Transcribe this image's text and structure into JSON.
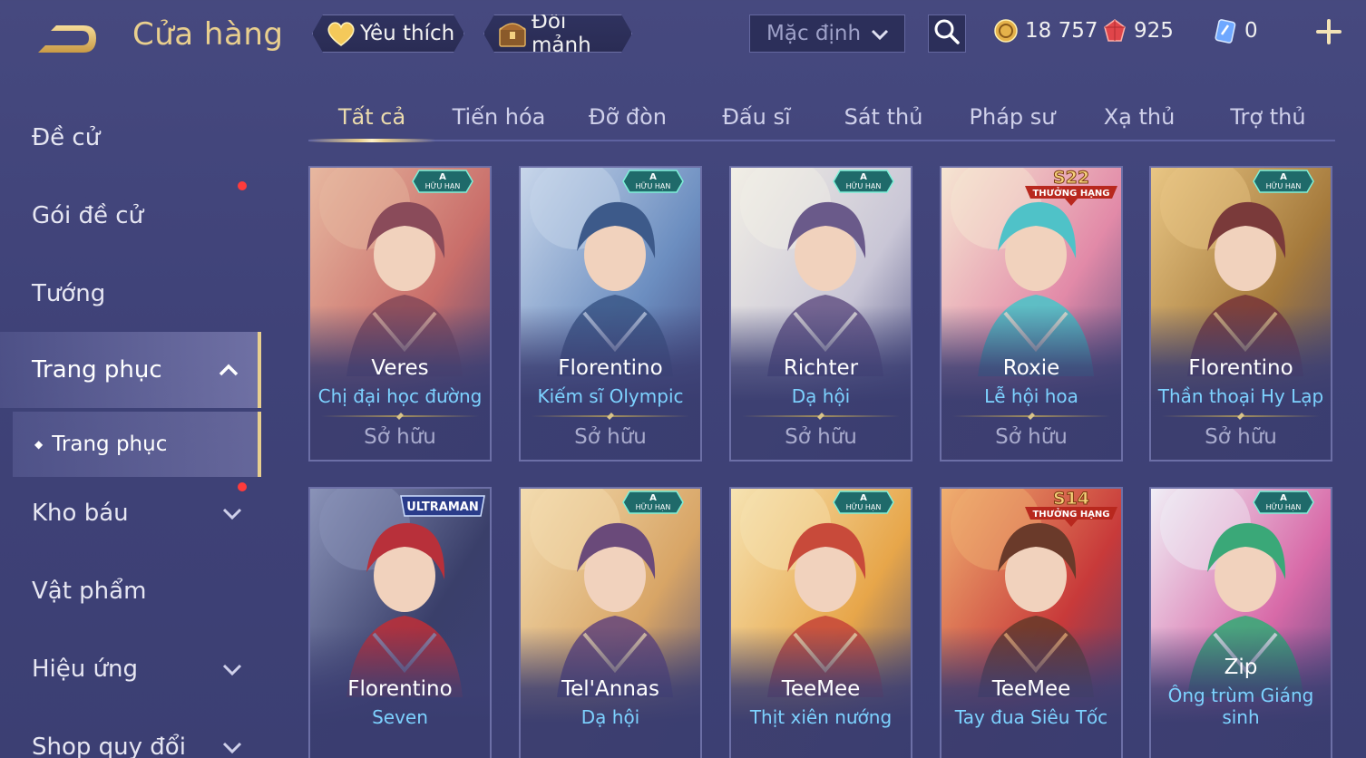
{
  "header": {
    "title": "Cửa hàng",
    "favorite_label": "Yêu thích",
    "exchange_label": "Đổi mảnh",
    "sort_value": "Mặc định",
    "currencies": {
      "gold": "18 757",
      "ruby": "925",
      "voucher": "0"
    }
  },
  "sidebar": {
    "items": [
      {
        "label": "Đề cử"
      },
      {
        "label": "Gói đề cử"
      },
      {
        "label": "Tướng"
      },
      {
        "label": "Trang phục"
      },
      {
        "label": "Kho báu"
      },
      {
        "label": "Vật phẩm"
      },
      {
        "label": "Hiệu ứng"
      },
      {
        "label": "Shop quy đổi"
      }
    ],
    "sub_item": "Trang phục"
  },
  "tabs": [
    "Tất cả",
    "Tiến hóa",
    "Đỡ đòn",
    "Đấu sĩ",
    "Sát thủ",
    "Pháp sư",
    "Xạ thủ",
    "Trợ thủ"
  ],
  "badges": {
    "a_top": "A",
    "a_sub": "HỮU HẠN",
    "rank": "THƯỞNG HẠNG",
    "ultraman": "ULTRAMAN"
  },
  "cards": [
    {
      "hero": "Veres",
      "skin": "Chị đại học đường",
      "status": "Sở hữu",
      "badge": "A",
      "colors": [
        "#c96e6a",
        "#e7b8a0",
        "#8a4b5a"
      ]
    },
    {
      "hero": "Florentino",
      "skin": "Kiếm sĩ Olympic",
      "status": "Sở hữu",
      "badge": "A",
      "colors": [
        "#6c8ec0",
        "#c8d6ea",
        "#3d5a8a"
      ]
    },
    {
      "hero": "Richter",
      "skin": "Dạ hội",
      "status": "Sở hữu",
      "badge": "A",
      "colors": [
        "#c9c6d6",
        "#f2efe6",
        "#6a5a8a"
      ]
    },
    {
      "hero": "Roxie",
      "skin": "Lễ hội hoa",
      "status": "Sở hữu",
      "badge": "S22",
      "colors": [
        "#e28aa8",
        "#f6e6d2",
        "#4fc2c8"
      ]
    },
    {
      "hero": "Florentino",
      "skin": "Thần thoại Hy Lạp",
      "status": "Sở hữu",
      "badge": "A",
      "colors": [
        "#a57a3c",
        "#e9c684",
        "#7a3a3a"
      ]
    },
    {
      "hero": "Florentino",
      "skin": "Seven",
      "status": "",
      "badge": "ULTRAMAN",
      "colors": [
        "#3a3f6a",
        "#8a93b8",
        "#b8303a"
      ]
    },
    {
      "hero": "Tel'Annas",
      "skin": "Dạ hội",
      "status": "",
      "badge": "A",
      "colors": [
        "#d8a566",
        "#f3dcb0",
        "#6a4a7a"
      ]
    },
    {
      "hero": "TeeMee",
      "skin": "Thịt xiên nướng",
      "status": "",
      "badge": "A",
      "colors": [
        "#e7a64a",
        "#f6e3b2",
        "#c84a3a"
      ]
    },
    {
      "hero": "TeeMee",
      "skin": "Tay đua Siêu Tốc",
      "status": "",
      "badge": "S14",
      "colors": [
        "#c83a3a",
        "#f0b070",
        "#6a3a2a"
      ]
    },
    {
      "hero": "Zip",
      "skin": "Ông trùm Giáng sinh",
      "status": "",
      "badge": "A",
      "colors": [
        "#d86aa8",
        "#f0eef6",
        "#3aa878"
      ]
    }
  ]
}
